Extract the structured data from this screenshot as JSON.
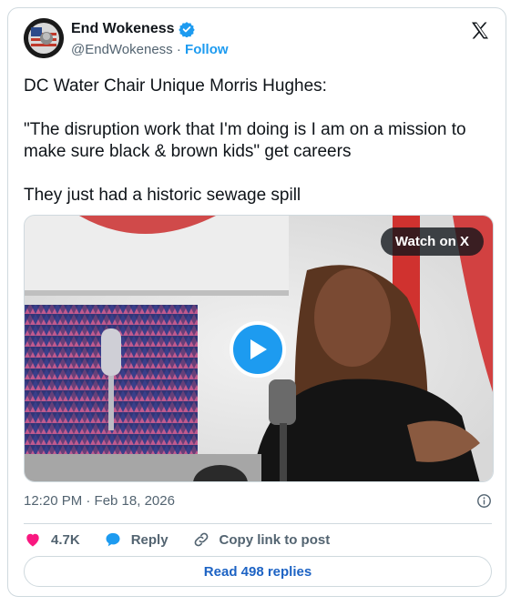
{
  "author": {
    "name": "End Wokeness",
    "handle": "@EndWokeness",
    "separator": "·",
    "follow_label": "Follow"
  },
  "tweet": {
    "lines": [
      "DC Water Chair Unique Morris Hughes:",
      "\"The disruption work that I'm doing is I am on a mission to make sure black & brown kids\" get careers",
      "They just had a historic sewage spill"
    ]
  },
  "media": {
    "watch_label": "Watch on X"
  },
  "meta": {
    "timestamp": "12:20 PM · Feb 18, 2026"
  },
  "actions": {
    "likes": "4.7K",
    "reply_label": "Reply",
    "copy_link_label": "Copy link to post"
  },
  "footer": {
    "read_replies_label": "Read 498 replies"
  },
  "colors": {
    "accent": "#1d9bf0",
    "like": "#f91880",
    "border": "#cfd9de"
  }
}
